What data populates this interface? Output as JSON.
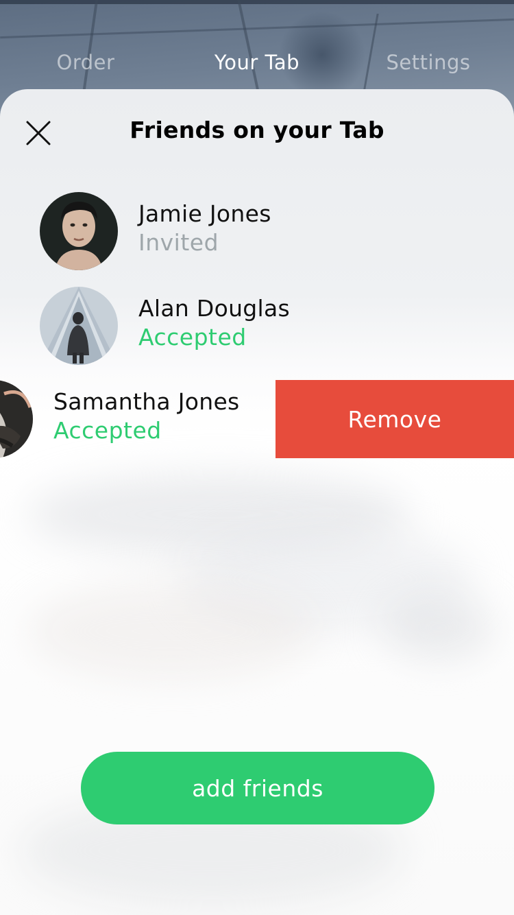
{
  "nav": {
    "tabs": [
      {
        "label": "Order",
        "active": false
      },
      {
        "label": "Your Tab",
        "active": true
      },
      {
        "label": "Settings",
        "active": false
      }
    ]
  },
  "sheet": {
    "title": "Friends on your Tab",
    "close_icon": "close-icon"
  },
  "friends": [
    {
      "name": "Jamie Jones",
      "status": "Invited",
      "status_color": "#9ea6aa"
    },
    {
      "name": "Alan Douglas",
      "status": "Accepted",
      "status_color": "#2ecc71"
    },
    {
      "name": "Samantha Jones",
      "status": "Accepted",
      "status_color": "#2ecc71",
      "swiped": true
    }
  ],
  "row_action": {
    "label": "Remove",
    "color": "#e74c3c"
  },
  "add_button": {
    "label": "add friends",
    "color": "#2ecc71"
  }
}
